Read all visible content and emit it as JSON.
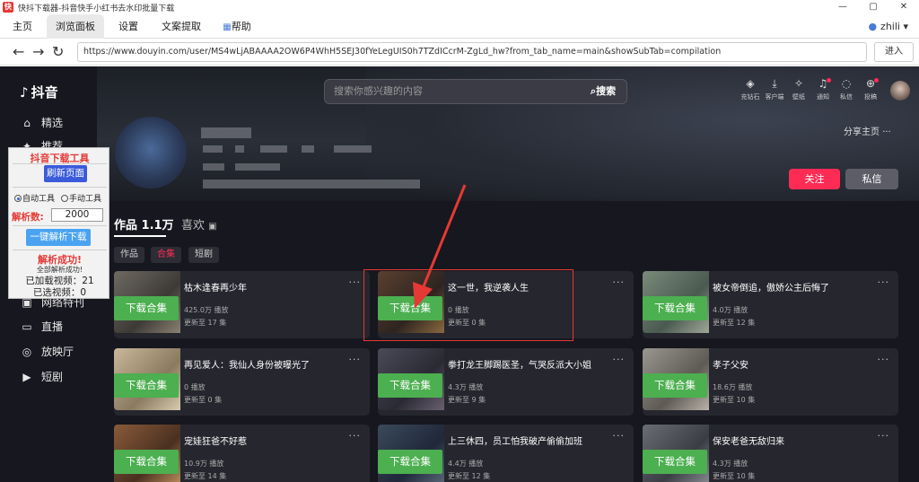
{
  "window": {
    "title": "快抖下载器-抖音快手小红书去水印批量下载",
    "app_icon": "快",
    "minimize": "—",
    "maximize": "▢",
    "close": "✕"
  },
  "tabs": [
    {
      "label": "主页"
    },
    {
      "label": "浏览面板"
    },
    {
      "label": "设置"
    },
    {
      "label": "文案提取"
    },
    {
      "label": "帮助"
    }
  ],
  "user": {
    "name": "zhili",
    "caret": "▾"
  },
  "address": {
    "url": "https://www.douyin.com/user/MS4wLjABAAAA2OW6P4WhH5SEJ30fYeLegUIS0h7TZdICcrM-ZgLd_hw?from_tab_name=main&showSubTab=compilation",
    "go_label": "进入"
  },
  "douyin": {
    "logo": "抖音",
    "search_placeholder": "搜索你感兴趣的内容",
    "search_button": "搜索",
    "top_icons": [
      {
        "label": "充钻石",
        "icon": "diamond-icon",
        "glyph": "◈"
      },
      {
        "label": "客户端",
        "icon": "download-icon",
        "glyph": "⤓"
      },
      {
        "label": "壁纸",
        "icon": "wallpaper-icon",
        "glyph": "✧"
      },
      {
        "label": "通知",
        "icon": "bell-icon",
        "glyph": "♫"
      },
      {
        "label": "私信",
        "icon": "message-icon",
        "glyph": "◌"
      },
      {
        "label": "投稿",
        "icon": "upload-icon",
        "glyph": "⊕"
      }
    ],
    "nav": [
      {
        "label": "精选",
        "icon": "home-icon",
        "glyph": "⌂"
      },
      {
        "label": "推荐",
        "icon": "recommend-icon",
        "glyph": "✦"
      },
      {
        "label": "网络特刊",
        "icon": "special-icon",
        "glyph": "▣"
      },
      {
        "label": "直播",
        "icon": "tv-icon",
        "glyph": "▭"
      },
      {
        "label": "放映厅",
        "icon": "cinema-icon",
        "glyph": "◎"
      },
      {
        "label": "短剧",
        "icon": "drama-icon",
        "glyph": "▶"
      }
    ],
    "share_label": "分享主页",
    "follow_label": "关注",
    "message_label": "私信",
    "works_label": "作品 1.1万",
    "likes_label": "喜欢",
    "chips": [
      "作品",
      "合集",
      "短剧"
    ]
  },
  "cards": [
    {
      "title": "枯木逢春再少年",
      "plays": "425.0万 播放",
      "updated": "更新至 17 集"
    },
    {
      "title": "这一世，我逆袭人生",
      "plays": "0 播放",
      "updated": "更新至 0 集"
    },
    {
      "title": "被女帝倒追，傲娇公主后悔了",
      "plays": "4.0万 播放",
      "updated": "更新至 12 集"
    },
    {
      "title": "再见爱人：我仙人身份被曝光了",
      "plays": "0 播放",
      "updated": "更新至 0 集"
    },
    {
      "title": "拳打龙王脚踢医圣，气哭反派大小姐",
      "plays": "4.3万 播放",
      "updated": "更新至 9 集"
    },
    {
      "title": "孝子父安",
      "plays": "18.6万 播放",
      "updated": "更新至 10 集"
    },
    {
      "title": "宠娃狂爸不好惹",
      "plays": "10.9万 播放",
      "updated": "更新至 14 集"
    },
    {
      "title": "上三休四，员工怕我破产偷偷加班",
      "plays": "4.4万 播放",
      "updated": "更新至 12 集"
    },
    {
      "title": "保安老爸无敌归来",
      "plays": "4.3万 播放",
      "updated": "更新至 10 集"
    }
  ],
  "download_label": "下载合集",
  "more_label": "···",
  "tool": {
    "title": "抖音下载工具",
    "refresh": "刷新页面",
    "auto_label": "自动工具",
    "manual_label": "手动工具",
    "count_label": "解析数:",
    "count_value": "2000",
    "parse_button": "一键解析下载",
    "success": "解析成功!",
    "all_success": "全部解析成功!",
    "loaded": "已加载视频：21",
    "selected": "已选视频：0"
  },
  "colors": {
    "accent": "#fe2c55",
    "download": "#4caf50",
    "highlight": "#e53935"
  }
}
